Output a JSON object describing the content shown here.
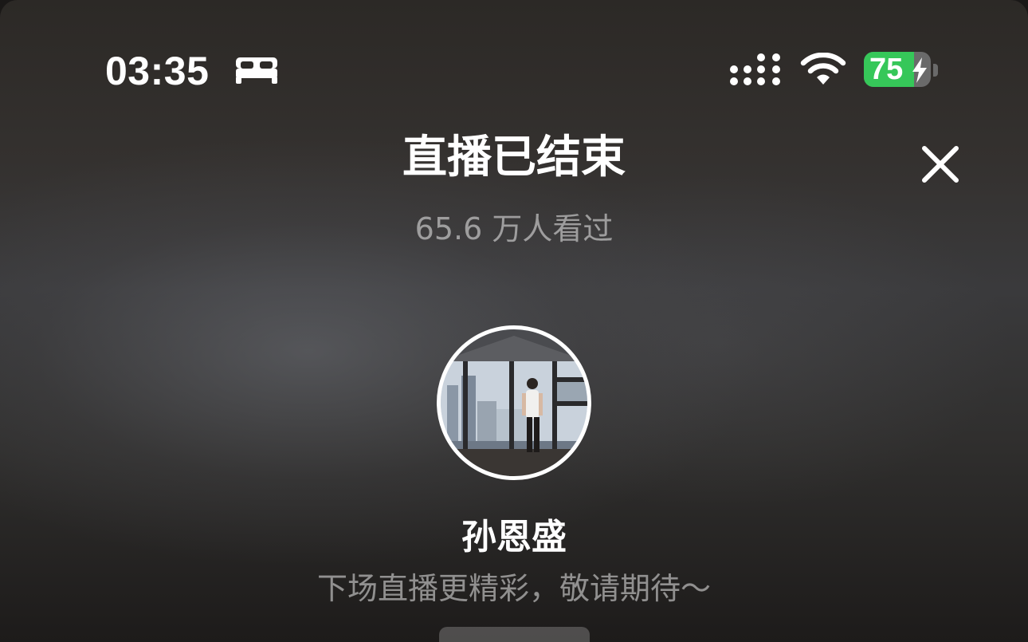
{
  "status_bar": {
    "time": "03:35",
    "focus_mode_icon": "bed-icon",
    "signal_icon": "cellular-signal-icon",
    "wifi_icon": "wifi-icon",
    "battery_level": "75",
    "battery_fraction": 0.75,
    "battery_charging": true,
    "battery_color": "#36c759"
  },
  "header": {
    "title": "直播已结束",
    "close_icon": "close-icon",
    "viewers_text": "65.6 万人看过"
  },
  "streamer": {
    "name": "孙恩盛",
    "message": "下场直播更精彩，敬请期待～",
    "avatar_icon": "avatar"
  }
}
